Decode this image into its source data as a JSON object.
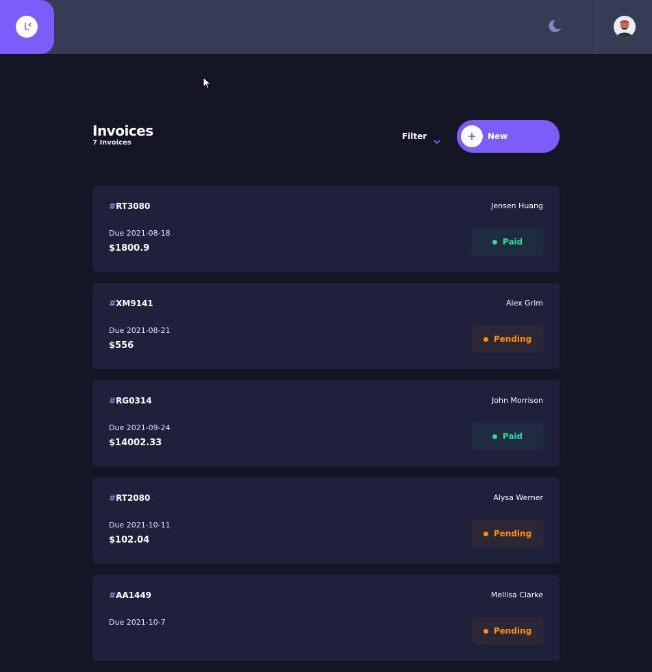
{
  "topbar": {
    "logo_icon": "app-logo-icon",
    "theme_icon": "moon-icon",
    "avatar_icon": "user-avatar",
    "colors": {
      "bar": "#373b53",
      "accent": "#7c5dfa"
    }
  },
  "header": {
    "title": "Invoices",
    "subtitle": "7 Invoices",
    "filter_label": "Filter",
    "new_button_label": "New",
    "new_button_icon": "plus-icon"
  },
  "invoices": [
    {
      "hash": "#",
      "id": "RT3080",
      "client": "Jensen Huang",
      "due": "Due 2021-08-18",
      "amount": "$1800.9",
      "status": "Paid"
    },
    {
      "hash": "#",
      "id": "XM9141",
      "client": "Alex Grim",
      "due": "Due 2021-08-21",
      "amount": "$556",
      "status": "Pending"
    },
    {
      "hash": "#",
      "id": "RG0314",
      "client": "John Morrison",
      "due": "Due 2021-09-24",
      "amount": "$14002.33",
      "status": "Paid"
    },
    {
      "hash": "#",
      "id": "RT2080",
      "client": "Alysa Werner",
      "due": "Due 2021-10-11",
      "amount": "$102.04",
      "status": "Pending"
    },
    {
      "hash": "#",
      "id": "AA1449",
      "client": "Mellisa Clarke",
      "due": "Due 2021-10-7",
      "amount": "",
      "status": "Pending"
    }
  ],
  "status_colors": {
    "Paid": "#33d69f",
    "Pending": "#ff8f00"
  }
}
